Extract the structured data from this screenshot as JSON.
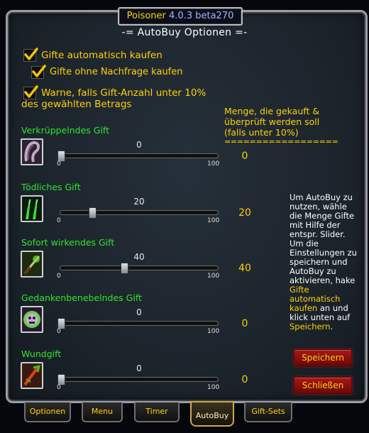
{
  "window": {
    "title_name": "Poisoner",
    "title_version": "4.0.3 beta270",
    "header": "-= AutoBuy Optionen =-"
  },
  "options": [
    {
      "label": "Gifte automatisch kaufen",
      "checked": true
    },
    {
      "label": "Gifte ohne Nachfrage kaufen",
      "checked": true
    },
    {
      "label_line1": "Warne, falls Gift-Anzahl unter 10%",
      "label_line2": "des gewählten Betrags",
      "checked": true
    }
  ],
  "info": {
    "line1": "Menge, die gekauft &",
    "line2": "überprüft werden soll",
    "line3": "(falls unter 10%)",
    "separator": "=================="
  },
  "slider_min_label": "0",
  "slider_max_label": "100",
  "poisons": [
    {
      "name": "Verkrüppelndes Gift",
      "value": 0,
      "value_text": "0",
      "amount": "0",
      "icon": "crippling-poison-icon"
    },
    {
      "name": "Tödliches Gift",
      "value": 20,
      "value_text": "20",
      "amount": "20",
      "icon": "deadly-poison-icon"
    },
    {
      "name": "Sofort wirkendes Gift",
      "value": 40,
      "value_text": "40",
      "amount": "40",
      "icon": "instant-poison-icon"
    },
    {
      "name": "Gedankenbenebelndes Gift",
      "value": 0,
      "value_text": "0",
      "amount": "0",
      "icon": "mind-numbing-poison-icon"
    },
    {
      "name": "Wundgift",
      "value": 0,
      "value_text": "0",
      "amount": "0",
      "icon": "wound-poison-icon"
    }
  ],
  "help": {
    "part1": "Um AutoBuy zu nutzen, wähle die Menge Gifte mit Hilfe der entspr. Slider. Um die Einstellungen zu speichern und AutoBuy zu aktivieren, hake ",
    "highlight1": "Gifte automatisch kaufen",
    "part2": " an und klick unten auf ",
    "highlight2": "Speichern",
    "part3": "."
  },
  "buttons": {
    "save": "Speichern",
    "close": "Schließen"
  },
  "tabs": [
    {
      "label": "Optionen",
      "active": false
    },
    {
      "label": "Menu",
      "active": false
    },
    {
      "label": "Timer",
      "active": false
    },
    {
      "label": "AutoBuy",
      "active": true
    },
    {
      "label": "Gift-Sets",
      "active": false
    }
  ],
  "colors": {
    "accent": "#ffd200",
    "poison_name": "#2ee62e",
    "version": "#a8b0ff",
    "button": "#a81818"
  }
}
